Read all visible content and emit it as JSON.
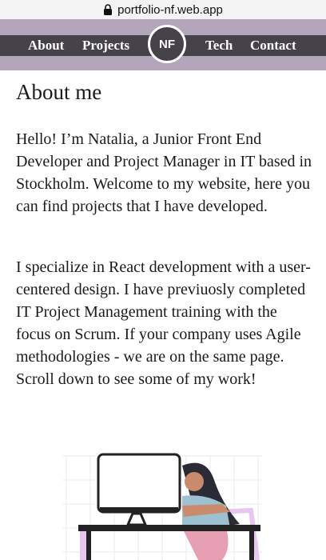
{
  "browser": {
    "url": "portfolio-nf.web.app"
  },
  "nav": {
    "items": [
      {
        "label": "About"
      },
      {
        "label": "Projects"
      },
      {
        "label": "Tech"
      },
      {
        "label": "Contact"
      }
    ],
    "logo_text": "NF"
  },
  "about": {
    "title": "About me",
    "paragraphs": [
      "Hello! I’m Natalia, a Junior Front End Developer and Project Manager in IT based in Stockholm. Welcome to my website, here you can find projects that I have developed.",
      "I specialize in React development with a user-centered design. I have previuosly completed IT Project Management training with the focus on Scrum. If your company uses Agile methodologies - we are on the same page. Scroll down to see some of my work!"
    ]
  },
  "colors": {
    "nav_outer": "#b3a5ba",
    "nav_band": "#46424a",
    "text": "#1a1a1a"
  },
  "icons": [
    "lock-icon",
    "developer-illustration"
  ]
}
